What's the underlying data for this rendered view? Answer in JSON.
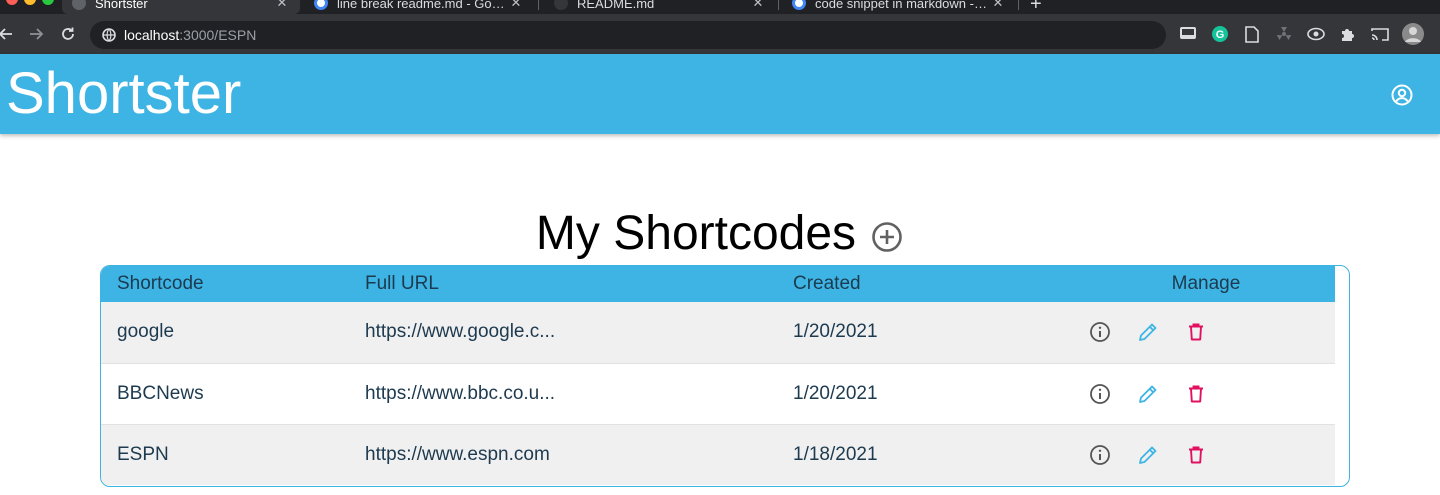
{
  "browser": {
    "tabs": [
      {
        "title": "Shortster",
        "active": true
      },
      {
        "title": "line break readme.md - Google Search",
        "active": false
      },
      {
        "title": "README.md",
        "active": false
      },
      {
        "title": "code snippet in markdown - Google Search",
        "active": false
      }
    ],
    "url_host": "localhost",
    "url_path": ":3000/ESPN",
    "new_tab_label": "+"
  },
  "app": {
    "brand": "Shortster",
    "brand_color": "#3db4e3"
  },
  "page": {
    "title": "My Shortcodes"
  },
  "table": {
    "columns": [
      "Shortcode",
      "Full URL",
      "Created",
      "Manage"
    ],
    "rows": [
      {
        "shortcode": "google",
        "full_url": "https://www.google.c...",
        "created": "1/20/2021"
      },
      {
        "shortcode": "BBCNews",
        "full_url": "https://www.bbc.co.u...",
        "created": "1/20/2021"
      },
      {
        "shortcode": "ESPN",
        "full_url": "https://www.espn.com",
        "created": "1/18/2021"
      }
    ],
    "action_icons": [
      "info-icon",
      "edit-icon",
      "delete-icon"
    ],
    "colors": {
      "info": "#555555",
      "edit": "#3db4e3",
      "delete": "#e0115f"
    }
  }
}
